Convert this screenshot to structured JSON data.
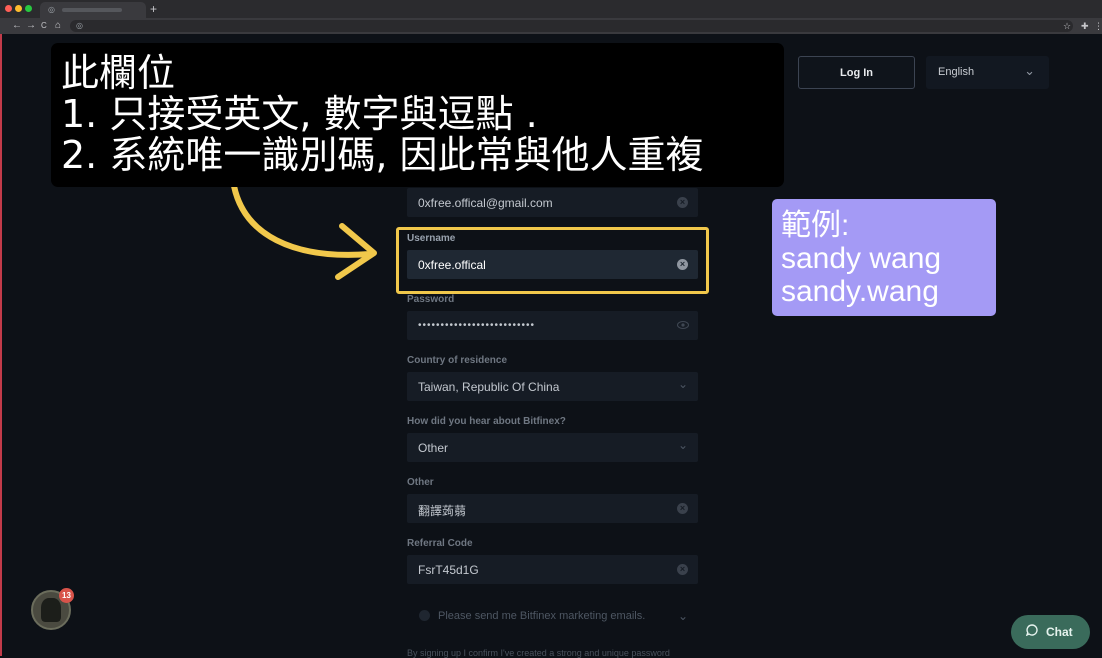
{
  "browser": {
    "new_tab": "+",
    "back": "←",
    "forward": "→",
    "reload": "C",
    "home": "⌂"
  },
  "header": {
    "login_label": "Log In",
    "language": "English"
  },
  "form": {
    "email_value": "0xfree.offical@gmail.com",
    "username_label": "Username",
    "username_value": "0xfree.offical",
    "password_label": "Password",
    "password_value": "••••••••••••••••••••••••••",
    "country_label": "Country of residence",
    "country_value": "Taiwan, Republic Of China",
    "hear_label": "How did you hear about Bitfinex?",
    "hear_value": "Other",
    "other_label": "Other",
    "other_value": "翻譯蒟蒻",
    "referral_label": "Referral Code",
    "referral_value": "FsrT45d1G",
    "marketing_label": "Please send me Bitfinex marketing emails.",
    "disclaimer": "By signing up I confirm I've created a strong and unique password"
  },
  "annotation": {
    "lines": [
      "此欄位",
      "1. 只接受英文, 數字與逗點 .",
      "2. 系統唯一識別碼, 因此常與他人重複"
    ],
    "example_lines": [
      "範例:",
      "sandy wang",
      "sandy.wang"
    ]
  },
  "widgets": {
    "notification_count": "13",
    "chat_label": "Chat"
  },
  "colors": {
    "highlight": "#f1c84b",
    "example_bg": "#a49af5",
    "chat_bg": "#3a6b5b",
    "badge": "#d8534a"
  }
}
